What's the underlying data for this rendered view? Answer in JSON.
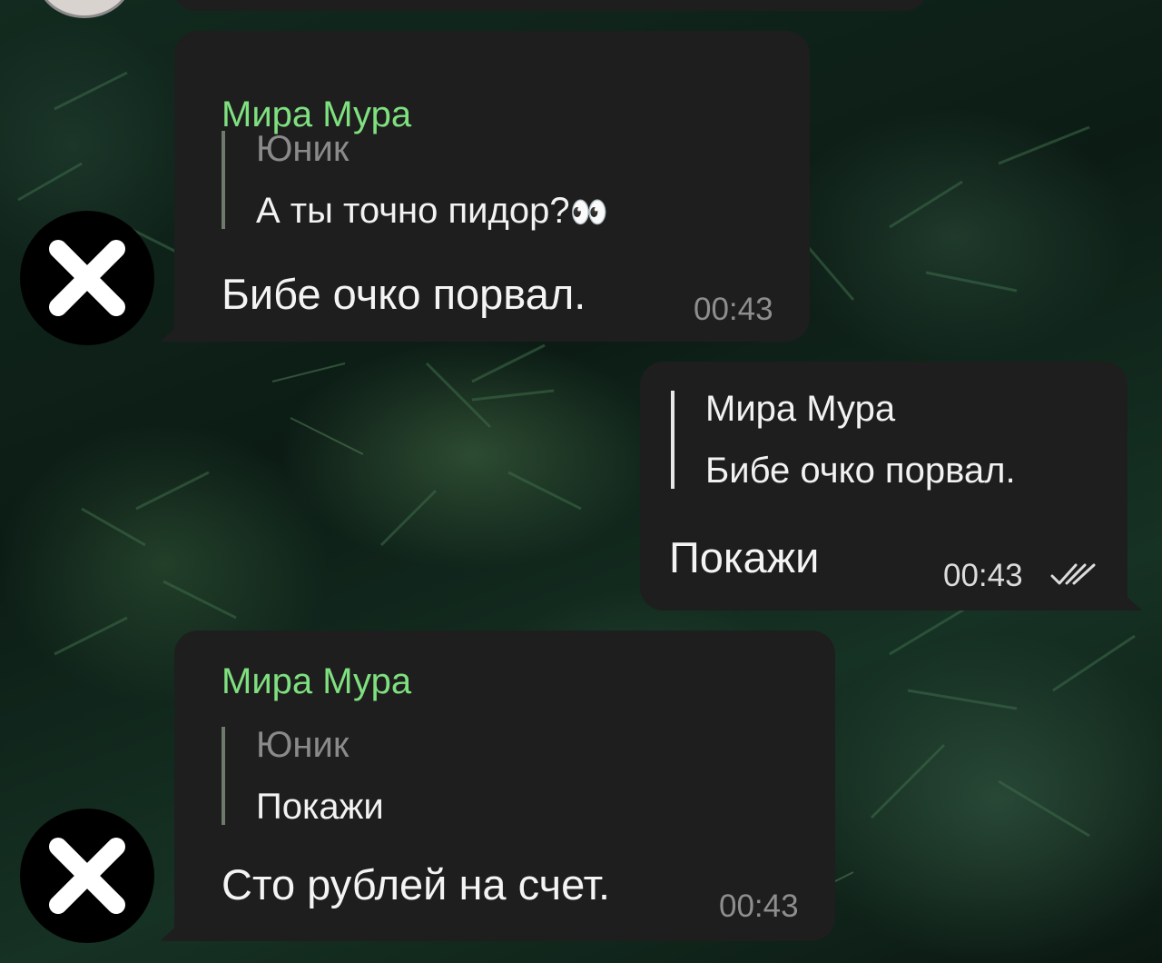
{
  "messages": [
    {
      "direction": "incoming",
      "sender": "Мира Мура",
      "reply_author": "Юник",
      "reply_text": "А ты точно пидор?",
      "reply_emoji": "👀",
      "text": "Бибе очко порвал.",
      "time": "00:43",
      "avatar_icon": "x-mark-icon"
    },
    {
      "direction": "outgoing",
      "reply_author": "Мира Мура",
      "reply_text": "Бибе очко порвал.",
      "text": "Покажи",
      "time": "00:43",
      "status_icon": "double-check-icon"
    },
    {
      "direction": "incoming",
      "sender": "Мира Мура",
      "reply_author": "Юник",
      "reply_text": "Покажи",
      "text": "Сто рублей на счет.",
      "time": "00:43",
      "avatar_icon": "x-mark-icon"
    }
  ],
  "colors": {
    "bubble": "#1e1e1e",
    "sender_name": "#7fe07f",
    "text": "#f4f4f4",
    "muted": "#8e8e8e"
  }
}
